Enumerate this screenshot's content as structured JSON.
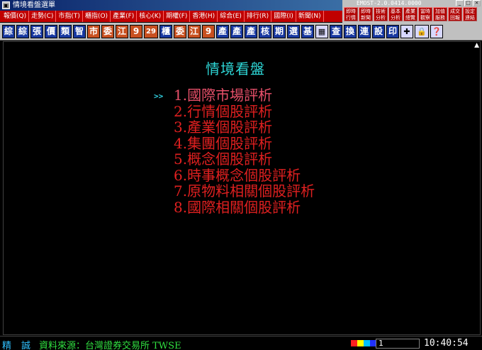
{
  "window": {
    "title": "情境看盤選單",
    "version": "EMOST-2.0.0414.0000"
  },
  "menubar": [
    "報價(Q)",
    "走勢(C)",
    "市指(T)",
    "櫃指(O)",
    "產業(F)",
    "核心(K)",
    "期權(F)",
    "香港(H)",
    "綜合(E)",
    "排行(R)",
    "國際(I)",
    "新聞(N)"
  ],
  "quick_buttons": [
    [
      "即時",
      "行情"
    ],
    [
      "即時",
      "新聞"
    ],
    [
      "技術",
      "分析"
    ],
    [
      "基本",
      "分析"
    ],
    [
      "產業",
      "總覽"
    ],
    [
      "當時",
      "觀察"
    ],
    [
      "加值",
      "服務"
    ],
    [
      "成交",
      "回報"
    ],
    [
      "設定",
      "連結"
    ]
  ],
  "window_buttons": [
    "_",
    "□",
    "×"
  ],
  "toolbar": [
    {
      "label": "綜",
      "style": "blue"
    },
    {
      "label": "綜",
      "style": "blue"
    },
    {
      "label": "張",
      "style": "blue"
    },
    {
      "label": "價",
      "style": "blue"
    },
    {
      "label": "類",
      "style": "blue"
    },
    {
      "label": "智",
      "style": "blue"
    },
    {
      "label": "市",
      "style": "orange"
    },
    {
      "label": "委",
      "style": "orange"
    },
    {
      "label": "江",
      "style": "orange"
    },
    {
      "label": "9",
      "style": "orange"
    },
    {
      "label": "29",
      "style": "orange"
    },
    {
      "label": "櫃",
      "style": "blue"
    },
    {
      "label": "委",
      "style": "orange"
    },
    {
      "label": "江",
      "style": "orange"
    },
    {
      "label": "9",
      "style": "orange"
    },
    {
      "label": "產",
      "style": "blue"
    },
    {
      "label": "產",
      "style": "blue"
    },
    {
      "label": "產",
      "style": "blue"
    },
    {
      "label": "核",
      "style": "blue"
    },
    {
      "label": "期",
      "style": "blue"
    },
    {
      "label": "選",
      "style": "blue"
    },
    {
      "label": "基",
      "style": "blue"
    },
    {
      "label": "▦",
      "style": "icon"
    },
    {
      "label": "查",
      "style": "blue"
    },
    {
      "label": "換",
      "style": "blue"
    },
    {
      "label": "連",
      "style": "blue"
    },
    {
      "label": "設",
      "style": "blue"
    },
    {
      "label": "印",
      "style": "blue"
    },
    {
      "label": "✚",
      "style": "icon"
    },
    {
      "label": "🔒",
      "style": "icon"
    },
    {
      "label": "❓",
      "style": "icon"
    }
  ],
  "main": {
    "title": "情境看盤",
    "cursor": ">>",
    "options": [
      "1.國際市場評析",
      "2.行情個股評析",
      "3.產業個股評析",
      "4.集團個股評析",
      "5.概念個股評析",
      "6.時事概念個股評析",
      "7.原物料相關個股評析",
      "8.國際相關個股評析"
    ],
    "selected_index": 0
  },
  "status": {
    "mode1": "精",
    "mode2": "誠",
    "source": "資料來源：台灣證券交易所 TWSE",
    "count": "1",
    "time": "10:40:54",
    "colors": [
      "#ff2020",
      "#ffff00",
      "#00c0ff",
      "#2030ff"
    ]
  }
}
